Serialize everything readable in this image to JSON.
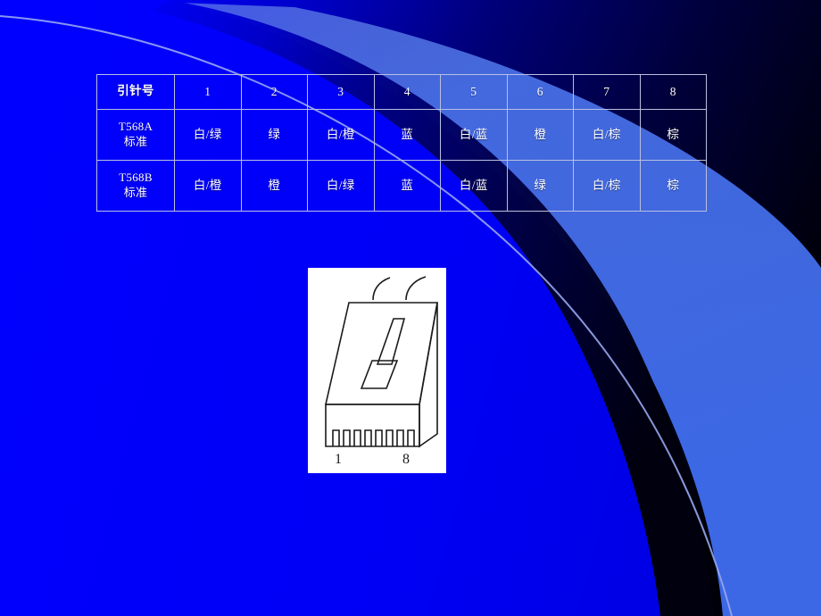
{
  "slide": {
    "background_color": "#0000ff",
    "accent_wedge_color": "#3d6ef0",
    "dark_band_color": "#000049",
    "curve_line_color": "#9aa9ef"
  },
  "table": {
    "header": [
      "引针号",
      "1",
      "2",
      "3",
      "4",
      "5",
      "6",
      "7",
      "8"
    ],
    "rows": [
      {
        "label_main": "T568A",
        "label_sub": "标准",
        "cells": [
          "白/绿",
          "绿",
          "白/橙",
          "蓝",
          "白/蓝",
          "橙",
          "白/棕",
          "棕"
        ]
      },
      {
        "label_main": "T568B",
        "label_sub": "标准",
        "cells": [
          "白/橙",
          "橙",
          "白/绿",
          "蓝",
          "白/蓝",
          "绿",
          "白/棕",
          "棕"
        ]
      }
    ]
  },
  "connector_image": {
    "name": "rj45-connector-diagram",
    "pin_label_first": "1",
    "pin_label_last": "8",
    "line_color": "#000000",
    "background": "#ffffff"
  }
}
